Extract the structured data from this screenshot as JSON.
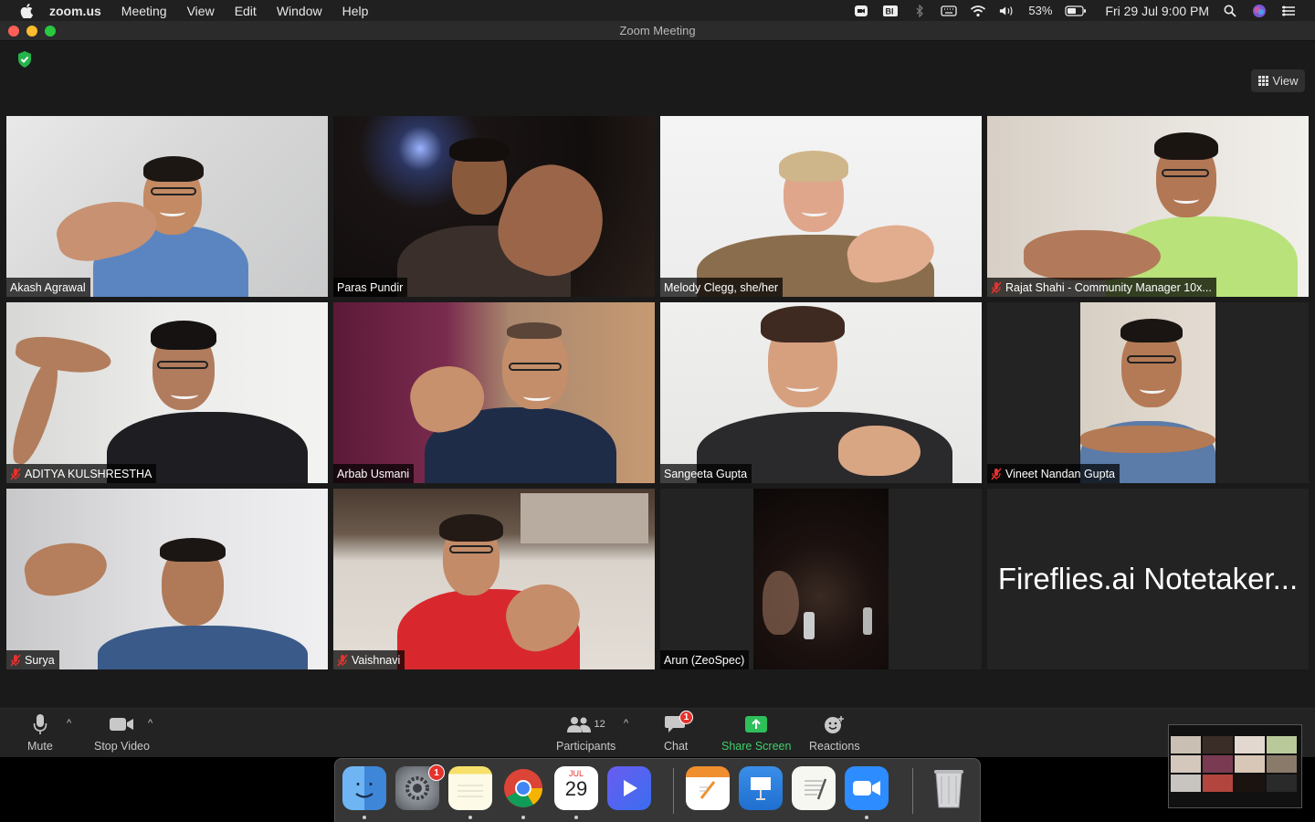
{
  "menubar": {
    "app_name": "zoom.us",
    "items": [
      "Meeting",
      "View",
      "Edit",
      "Window",
      "Help"
    ],
    "battery": "53%",
    "datetime": "Fri 29 Jul  9:00 PM"
  },
  "window": {
    "title": "Zoom Meeting",
    "view_label": "View"
  },
  "participants": [
    {
      "name": "Akash Agrawal",
      "muted": false
    },
    {
      "name": "Paras Pundir",
      "muted": false
    },
    {
      "name": "Melody Clegg, she/her",
      "muted": false
    },
    {
      "name": "Rajat Shahi - Community Manager 10x...",
      "muted": true
    },
    {
      "name": "ADITYA KULSHRESTHA",
      "muted": true
    },
    {
      "name": "Arbab Usmani",
      "muted": false
    },
    {
      "name": "Sangeeta Gupta",
      "muted": false
    },
    {
      "name": "Vineet Nandan Gupta",
      "muted": true
    },
    {
      "name": "Surya",
      "muted": true
    },
    {
      "name": "Vaishnavi",
      "muted": true
    },
    {
      "name": "Arun (ZeoSpec)",
      "muted": false
    },
    {
      "name": "Fireflies.ai Notetaker...",
      "muted": false
    }
  ],
  "toolbar": {
    "mute_label": "Mute",
    "stop_video_label": "Stop Video",
    "participants_label": "Participants",
    "participants_count": "12",
    "chat_label": "Chat",
    "chat_badge": "1",
    "share_screen_label": "Share Screen",
    "reactions_label": "Reactions"
  },
  "dock": {
    "settings_badge": "1",
    "calendar_month": "JUL",
    "calendar_day": "29"
  },
  "colors": {
    "active_speaker_border": "#d8f080",
    "share_green": "#3fd06b",
    "mute_red": "#e5322d"
  }
}
